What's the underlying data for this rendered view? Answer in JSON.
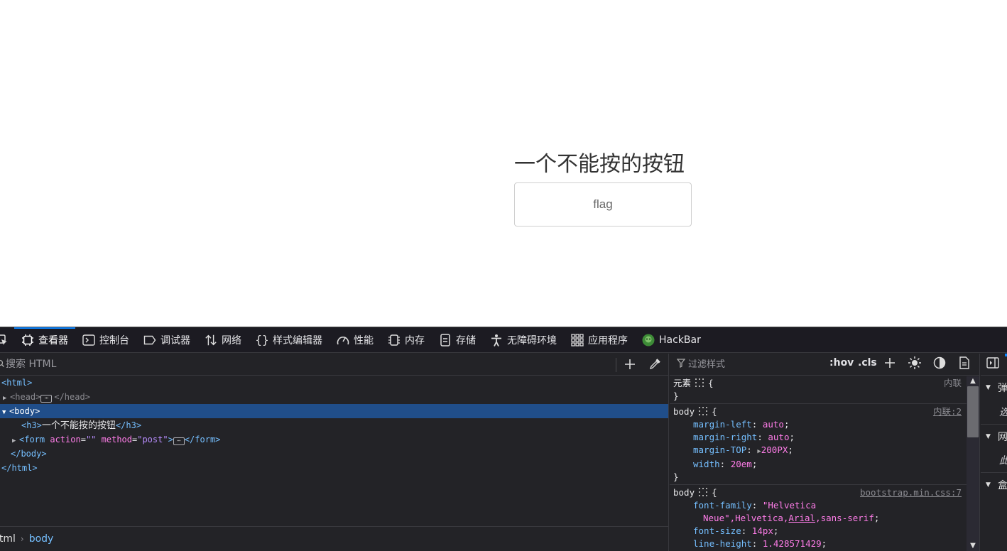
{
  "page": {
    "heading": "一个不能按的按钮",
    "button_label": "flag"
  },
  "devtools": {
    "tabs": [
      {
        "label": "查看器",
        "icon": "inspector-icon",
        "active": true
      },
      {
        "label": "控制台",
        "icon": "console-icon"
      },
      {
        "label": "调试器",
        "icon": "debugger-icon"
      },
      {
        "label": "网络",
        "icon": "network-icon"
      },
      {
        "label": "样式编辑器",
        "icon": "style-editor-icon"
      },
      {
        "label": "性能",
        "icon": "performance-icon"
      },
      {
        "label": "内存",
        "icon": "memory-icon"
      },
      {
        "label": "存储",
        "icon": "storage-icon"
      },
      {
        "label": "无障碍环境",
        "icon": "accessibility-icon"
      },
      {
        "label": "应用程序",
        "icon": "application-icon"
      },
      {
        "label": "HackBar",
        "icon": "hackbar-icon"
      }
    ],
    "inspector": {
      "search_placeholder": "搜索 HTML",
      "tree": {
        "html_open": "<html>",
        "head_open": "<head>",
        "head_close": "</head>",
        "body_open": "<body>",
        "h3_open": "<h3>",
        "h3_text": "一个不能按的按钮",
        "h3_close": "</h3>",
        "form_open_start": "<form",
        "form_attr1_name": "action",
        "form_attr1_value": "\"\"",
        "form_attr2_name": "method",
        "form_attr2_value": "\"post\"",
        "form_open_end": ">",
        "form_close": "</form>",
        "body_close": "</body>",
        "html_close": "</html>",
        "ellipsis": "⋯"
      },
      "breadcrumbs": [
        "html",
        "body"
      ]
    },
    "rules": {
      "filter_placeholder": "过滤样式",
      "hov_label": ":hov",
      "cls_label": ".cls",
      "element_rule": {
        "selector": "元素",
        "source": "内联"
      },
      "body_inline_rule": {
        "selector": "body",
        "source": "内联:2",
        "declarations": [
          {
            "name": "margin-left",
            "value": "auto"
          },
          {
            "name": "margin-right",
            "value": "auto"
          },
          {
            "name": "margin-TOP",
            "value": "200PX"
          },
          {
            "name": "width",
            "value": "20em"
          }
        ]
      },
      "body_bootstrap_rule": {
        "selector": "body",
        "source": "bootstrap.min.css:7",
        "font_family_name": "font-family",
        "font_family_value_1": "\"Helvetica",
        "font_family_value_2a": "Neue\",Helvetica,",
        "font_family_value_2b": "Arial",
        "font_family_value_2c": ",sans-serif",
        "font_size_name": "font-size",
        "font_size_value": "14px",
        "line_height_name": "line-height",
        "line_height_value": "1.428571429"
      }
    },
    "sidebar": {
      "items": [
        {
          "label": "弹",
          "type": "header"
        },
        {
          "label": "选",
          "type": "sub"
        },
        {
          "label": "网",
          "type": "header"
        },
        {
          "label": "此",
          "type": "sub"
        },
        {
          "label": "盒",
          "type": "header"
        }
      ]
    }
  }
}
